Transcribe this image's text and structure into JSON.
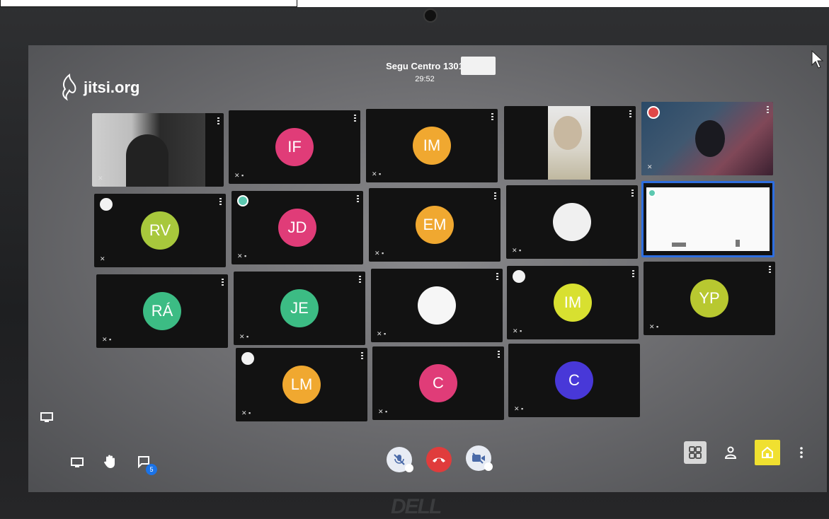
{
  "meeting": {
    "name": "Segu Centro 1301",
    "timer": "29:52"
  },
  "logo": {
    "text": "jitsi.org",
    "icon": "jitsi-logo-icon"
  },
  "tiles": [
    {
      "id": "v1",
      "type": "video",
      "label": ""
    },
    {
      "id": "IF",
      "type": "avatar",
      "initials": "IF",
      "color": "#e03c78"
    },
    {
      "id": "IM1",
      "type": "avatar",
      "initials": "IM",
      "color": "#f0a830"
    },
    {
      "id": "v2",
      "type": "video",
      "label": ""
    },
    {
      "id": "v3",
      "type": "video",
      "label": ""
    },
    {
      "id": "RV",
      "type": "avatar",
      "initials": "RV",
      "color": "#a8c83c"
    },
    {
      "id": "JD",
      "type": "avatar",
      "initials": "JD",
      "color": "#e03c78"
    },
    {
      "id": "EM",
      "type": "avatar",
      "initials": "EM",
      "color": "#f0a830"
    },
    {
      "id": "w1",
      "type": "avatar",
      "initials": "",
      "color": "#f0f0f0"
    },
    {
      "id": "share",
      "type": "screen",
      "label": ""
    },
    {
      "id": "RA",
      "type": "avatar",
      "initials": "RÁ",
      "color": "#3cbc84"
    },
    {
      "id": "JE",
      "type": "avatar",
      "initials": "JE",
      "color": "#3cbc84"
    },
    {
      "id": "w2",
      "type": "avatar",
      "initials": "",
      "color": "#f6f6f6"
    },
    {
      "id": "IM2",
      "type": "avatar",
      "initials": "IM",
      "color": "#d8e030"
    },
    {
      "id": "YP",
      "type": "avatar",
      "initials": "YP",
      "color": "#b8c830"
    },
    {
      "id": "LM",
      "type": "avatar",
      "initials": "LM",
      "color": "#f0a830"
    },
    {
      "id": "C1",
      "type": "avatar",
      "initials": "C",
      "color": "#e03c78"
    },
    {
      "id": "C2",
      "type": "avatar",
      "initials": "C",
      "color": "#4838d8"
    }
  ],
  "toolbar": {
    "chat_badge": "5",
    "left": [
      "screenshare-icon",
      "raise-hand-icon",
      "chat-icon"
    ],
    "center": [
      "mic-muted-icon",
      "hangup-icon",
      "camera-muted-icon"
    ],
    "right": [
      "tile-view-icon",
      "participants-icon",
      "invite-icon",
      "more-icon"
    ],
    "hangup_color": "#e03c3c",
    "tile_view_color": "#d8d8d8",
    "invite_color": "#f0e030"
  },
  "brand": "DELL"
}
